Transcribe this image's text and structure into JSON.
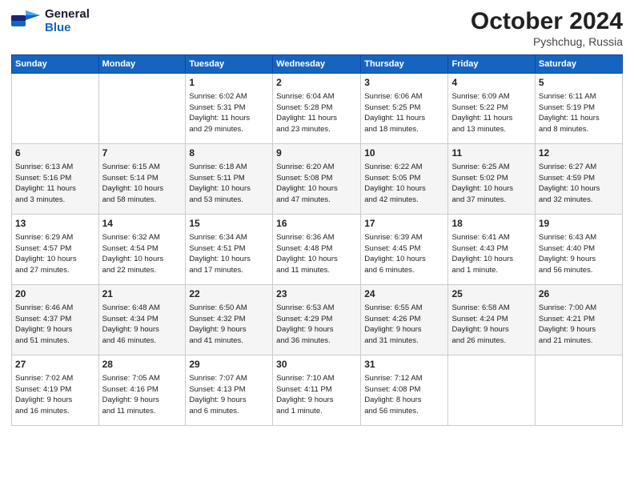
{
  "header": {
    "logo_line1": "General",
    "logo_line2": "Blue",
    "month": "October 2024",
    "location": "Pyshchug, Russia"
  },
  "days_of_week": [
    "Sunday",
    "Monday",
    "Tuesday",
    "Wednesday",
    "Thursday",
    "Friday",
    "Saturday"
  ],
  "weeks": [
    [
      {
        "day": "",
        "info": ""
      },
      {
        "day": "",
        "info": ""
      },
      {
        "day": "1",
        "info": "Sunrise: 6:02 AM\nSunset: 5:31 PM\nDaylight: 11 hours\nand 29 minutes."
      },
      {
        "day": "2",
        "info": "Sunrise: 6:04 AM\nSunset: 5:28 PM\nDaylight: 11 hours\nand 23 minutes."
      },
      {
        "day": "3",
        "info": "Sunrise: 6:06 AM\nSunset: 5:25 PM\nDaylight: 11 hours\nand 18 minutes."
      },
      {
        "day": "4",
        "info": "Sunrise: 6:09 AM\nSunset: 5:22 PM\nDaylight: 11 hours\nand 13 minutes."
      },
      {
        "day": "5",
        "info": "Sunrise: 6:11 AM\nSunset: 5:19 PM\nDaylight: 11 hours\nand 8 minutes."
      }
    ],
    [
      {
        "day": "6",
        "info": "Sunrise: 6:13 AM\nSunset: 5:16 PM\nDaylight: 11 hours\nand 3 minutes."
      },
      {
        "day": "7",
        "info": "Sunrise: 6:15 AM\nSunset: 5:14 PM\nDaylight: 10 hours\nand 58 minutes."
      },
      {
        "day": "8",
        "info": "Sunrise: 6:18 AM\nSunset: 5:11 PM\nDaylight: 10 hours\nand 53 minutes."
      },
      {
        "day": "9",
        "info": "Sunrise: 6:20 AM\nSunset: 5:08 PM\nDaylight: 10 hours\nand 47 minutes."
      },
      {
        "day": "10",
        "info": "Sunrise: 6:22 AM\nSunset: 5:05 PM\nDaylight: 10 hours\nand 42 minutes."
      },
      {
        "day": "11",
        "info": "Sunrise: 6:25 AM\nSunset: 5:02 PM\nDaylight: 10 hours\nand 37 minutes."
      },
      {
        "day": "12",
        "info": "Sunrise: 6:27 AM\nSunset: 4:59 PM\nDaylight: 10 hours\nand 32 minutes."
      }
    ],
    [
      {
        "day": "13",
        "info": "Sunrise: 6:29 AM\nSunset: 4:57 PM\nDaylight: 10 hours\nand 27 minutes."
      },
      {
        "day": "14",
        "info": "Sunrise: 6:32 AM\nSunset: 4:54 PM\nDaylight: 10 hours\nand 22 minutes."
      },
      {
        "day": "15",
        "info": "Sunrise: 6:34 AM\nSunset: 4:51 PM\nDaylight: 10 hours\nand 17 minutes."
      },
      {
        "day": "16",
        "info": "Sunrise: 6:36 AM\nSunset: 4:48 PM\nDaylight: 10 hours\nand 11 minutes."
      },
      {
        "day": "17",
        "info": "Sunrise: 6:39 AM\nSunset: 4:45 PM\nDaylight: 10 hours\nand 6 minutes."
      },
      {
        "day": "18",
        "info": "Sunrise: 6:41 AM\nSunset: 4:43 PM\nDaylight: 10 hours\nand 1 minute."
      },
      {
        "day": "19",
        "info": "Sunrise: 6:43 AM\nSunset: 4:40 PM\nDaylight: 9 hours\nand 56 minutes."
      }
    ],
    [
      {
        "day": "20",
        "info": "Sunrise: 6:46 AM\nSunset: 4:37 PM\nDaylight: 9 hours\nand 51 minutes."
      },
      {
        "day": "21",
        "info": "Sunrise: 6:48 AM\nSunset: 4:34 PM\nDaylight: 9 hours\nand 46 minutes."
      },
      {
        "day": "22",
        "info": "Sunrise: 6:50 AM\nSunset: 4:32 PM\nDaylight: 9 hours\nand 41 minutes."
      },
      {
        "day": "23",
        "info": "Sunrise: 6:53 AM\nSunset: 4:29 PM\nDaylight: 9 hours\nand 36 minutes."
      },
      {
        "day": "24",
        "info": "Sunrise: 6:55 AM\nSunset: 4:26 PM\nDaylight: 9 hours\nand 31 minutes."
      },
      {
        "day": "25",
        "info": "Sunrise: 6:58 AM\nSunset: 4:24 PM\nDaylight: 9 hours\nand 26 minutes."
      },
      {
        "day": "26",
        "info": "Sunrise: 7:00 AM\nSunset: 4:21 PM\nDaylight: 9 hours\nand 21 minutes."
      }
    ],
    [
      {
        "day": "27",
        "info": "Sunrise: 7:02 AM\nSunset: 4:19 PM\nDaylight: 9 hours\nand 16 minutes."
      },
      {
        "day": "28",
        "info": "Sunrise: 7:05 AM\nSunset: 4:16 PM\nDaylight: 9 hours\nand 11 minutes."
      },
      {
        "day": "29",
        "info": "Sunrise: 7:07 AM\nSunset: 4:13 PM\nDaylight: 9 hours\nand 6 minutes."
      },
      {
        "day": "30",
        "info": "Sunrise: 7:10 AM\nSunset: 4:11 PM\nDaylight: 9 hours\nand 1 minute."
      },
      {
        "day": "31",
        "info": "Sunrise: 7:12 AM\nSunset: 4:08 PM\nDaylight: 8 hours\nand 56 minutes."
      },
      {
        "day": "",
        "info": ""
      },
      {
        "day": "",
        "info": ""
      }
    ]
  ]
}
